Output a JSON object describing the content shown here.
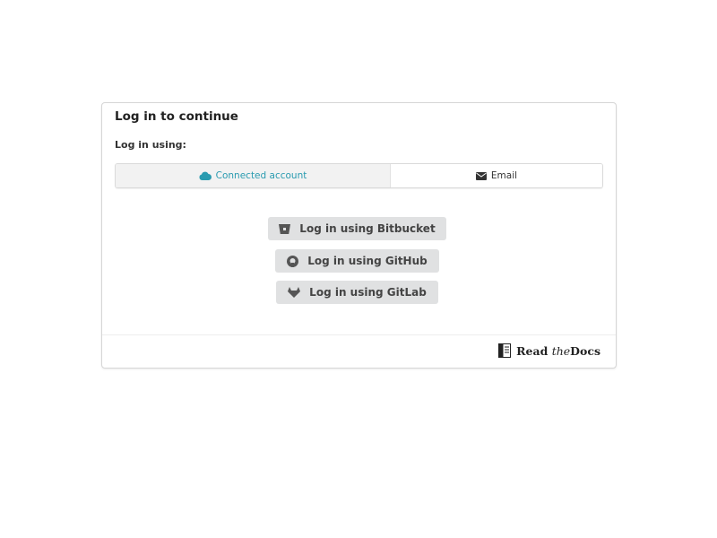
{
  "card": {
    "title": "Log in to continue",
    "label": "Log in using:",
    "tabs": [
      {
        "label": "Connected account",
        "icon": "cloud-icon",
        "active": true
      },
      {
        "label": "Email",
        "icon": "envelope-icon",
        "active": false
      }
    ],
    "buttons": [
      {
        "label": "Log in using Bitbucket",
        "icon": "bitbucket-icon"
      },
      {
        "label": "Log in using GitHub",
        "icon": "github-icon"
      },
      {
        "label": "Log in using GitLab",
        "icon": "gitlab-icon"
      }
    ],
    "footer": {
      "logo_read": "Read",
      "logo_the": "the",
      "logo_docs": "Docs"
    }
  },
  "colors": {
    "accent": "#2a9bb0",
    "button_bg": "#e0e1e2"
  }
}
